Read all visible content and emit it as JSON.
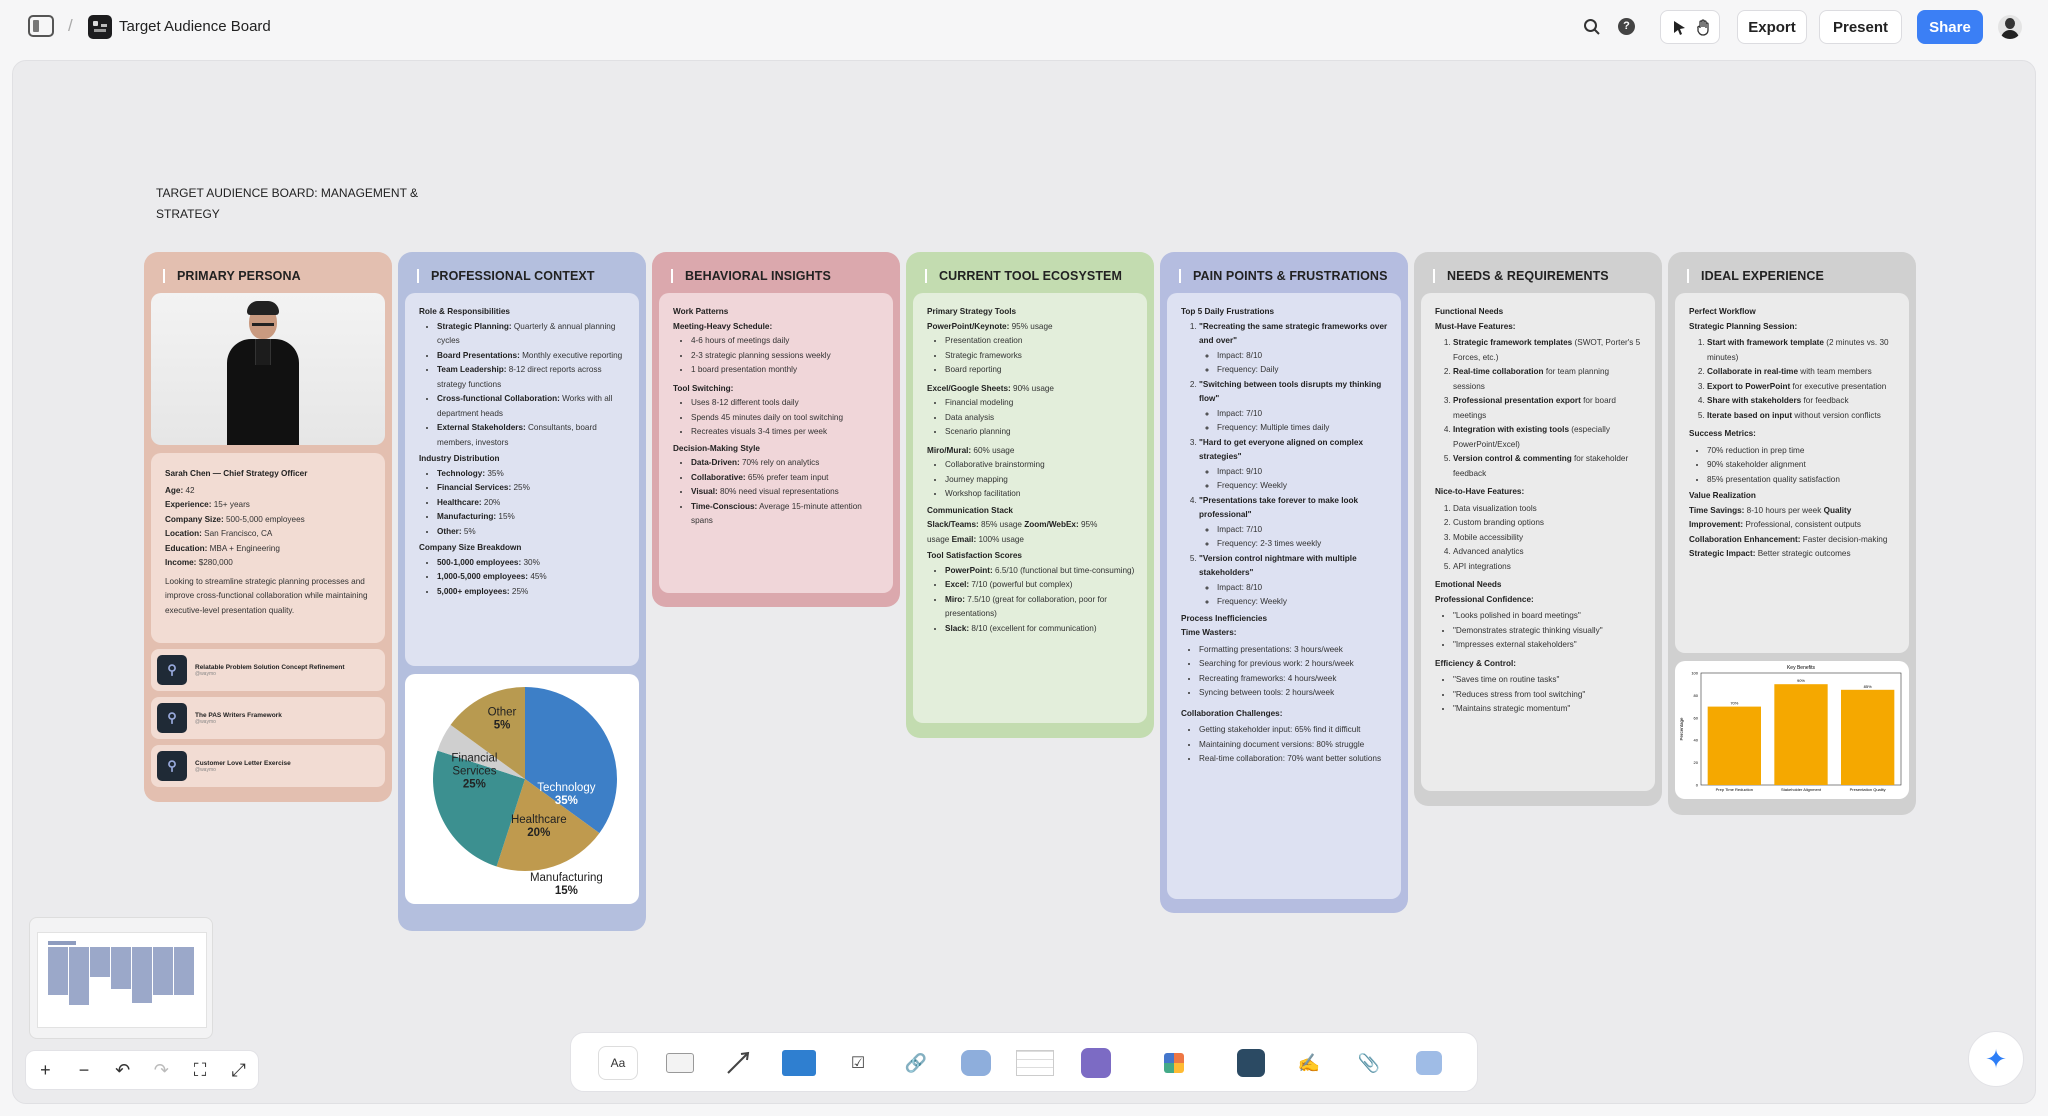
{
  "app": {
    "board_title": "Target Audience Board",
    "export_label": "Export",
    "present_label": "Present",
    "share_label": "Share",
    "accent": "#3b7ff5"
  },
  "board": {
    "heading_line1": "TARGET AUDIENCE BOARD: MANAGEMENT &",
    "heading_line2": "STRATEGY"
  },
  "persona": {
    "title": "PRIMARY PERSONA",
    "color": "#e3bfb0",
    "name_line": "Sarah Chen — Chief Strategy Officer",
    "fields": [
      {
        "k": "Age:",
        "v": "42"
      },
      {
        "k": "Experience:",
        "v": "15+ years"
      },
      {
        "k": "Company Size:",
        "v": "500-5,000 employees"
      },
      {
        "k": "Location:",
        "v": "San Francisco, CA"
      },
      {
        "k": "Education:",
        "v": "MBA + Engineering"
      },
      {
        "k": "Income:",
        "v": "$280,000"
      }
    ],
    "quote": "Looking to streamline strategic planning processes and improve cross-functional collaboration while maintaining executive-level presentation quality.",
    "links": [
      {
        "title": "Relatable Problem Solution Concept Refinement",
        "sub": "@waymo"
      },
      {
        "title": "The PAS Writers Framework",
        "sub": "@waymo"
      },
      {
        "title": "Customer Love Letter Exercise",
        "sub": "@waymo"
      }
    ]
  },
  "professional": {
    "title": "PROFESSIONAL CONTEXT",
    "color": "#b4bfde",
    "role_heading": "Role & Responsibilities",
    "roles": [
      {
        "k": "Strategic Planning:",
        "v": "Quarterly & annual planning cycles"
      },
      {
        "k": "Board Presentations:",
        "v": "Monthly executive reporting"
      },
      {
        "k": "Team Leadership:",
        "v": "8-12 direct reports across strategy functions"
      },
      {
        "k": "Cross-functional Collaboration:",
        "v": "Works with all department heads"
      },
      {
        "k": "External Stakeholders:",
        "v": "Consultants, board members, investors"
      }
    ],
    "industry_heading": "Industry Distribution",
    "industries": [
      {
        "k": "Technology:",
        "v": "35%"
      },
      {
        "k": "Financial Services:",
        "v": "25%"
      },
      {
        "k": "Healthcare:",
        "v": "20%"
      },
      {
        "k": "Manufacturing:",
        "v": "15%"
      },
      {
        "k": "Other:",
        "v": "5%"
      }
    ],
    "size_heading": "Company Size Breakdown",
    "sizes": [
      {
        "k": "500-1,000 employees:",
        "v": "30%"
      },
      {
        "k": "1,000-5,000 employees:",
        "v": "45%"
      },
      {
        "k": "5,000+ employees:",
        "v": "25%"
      }
    ]
  },
  "chart_data": [
    {
      "type": "pie",
      "categories": [
        "Technology",
        "Healthcare",
        "Financial Services",
        "Other",
        "Manufacturing"
      ],
      "values": [
        35,
        20,
        25,
        5,
        15
      ],
      "labels": [
        "Technology\n35%",
        "Healthcare\n20%",
        "Financial\nServices\n25%",
        "Other\n5%",
        "Manufacturing\n15%"
      ],
      "colors": [
        "#3d7fc7",
        "#bf9a4e",
        "#3c9090",
        "#cfcfcf",
        "#b89a50"
      ]
    },
    {
      "type": "bar",
      "title": "Key Benefits",
      "categories": [
        "Prep Time Reduction",
        "Stakeholder Alignment",
        "Presentation Quality"
      ],
      "values": [
        70,
        90,
        85
      ],
      "data_labels": [
        "70%",
        "90%",
        "85%"
      ],
      "ylabel": "Percentage",
      "ylim": [
        0,
        100
      ],
      "color": "#f5a800"
    }
  ],
  "behavioral": {
    "title": "BEHAVIORAL INSIGHTS",
    "color": "#dba8ad",
    "work_heading": "Work Patterns",
    "meeting_heading": "Meeting-Heavy Schedule:",
    "meeting": [
      "4-6 hours of meetings daily",
      "2-3 strategic planning sessions weekly",
      "1 board presentation monthly"
    ],
    "switch_heading": "Tool Switching:",
    "switching": [
      "Uses 8-12 different tools daily",
      "Spends 45 minutes daily on tool switching",
      "Recreates visuals 3-4 times per week"
    ],
    "decision_heading": "Decision-Making Style",
    "decision": [
      {
        "k": "Data-Driven:",
        "v": "70% rely on analytics"
      },
      {
        "k": "Collaborative:",
        "v": "65% prefer team input"
      },
      {
        "k": "Visual:",
        "v": "80% need visual representations"
      },
      {
        "k": "Time-Conscious:",
        "v": "Average 15-minute attention spans"
      }
    ]
  },
  "tools": {
    "title": "CURRENT TOOL ECOSYSTEM",
    "color": "#c3dcb0",
    "primary_heading": "Primary Strategy Tools",
    "ppt_heading": "PowerPoint/Keynote:",
    "ppt_usage": "95% usage",
    "ppt": [
      "Presentation creation",
      "Strategic frameworks",
      "Board reporting"
    ],
    "excel_heading": "Excel/Google Sheets:",
    "excel_usage": "90% usage",
    "excel": [
      "Financial modeling",
      "Data analysis",
      "Scenario planning"
    ],
    "miro_heading": "Miro/Mural:",
    "miro_usage": "60% usage",
    "miro": [
      "Collaborative brainstorming",
      "Journey mapping",
      "Workshop facilitation"
    ],
    "comm_heading": "Communication Stack",
    "comm_line1_a": "Slack/Teams:",
    "comm_line1_b": "85% usage",
    "comm_line1_c": "Zoom/WebEx:",
    "comm_line1_d": "95%",
    "comm_line2_a": "usage",
    "comm_line2_b": "Email:",
    "comm_line2_c": "100% usage",
    "sat_heading": "Tool Satisfaction Scores",
    "satisfaction": [
      {
        "k": "PowerPoint:",
        "v": "6.5/10 (functional but time-consuming)"
      },
      {
        "k": "Excel:",
        "v": "7/10 (powerful but complex)"
      },
      {
        "k": "Miro:",
        "v": "7.5/10 (great for collaboration, poor for presentations)"
      },
      {
        "k": "Slack:",
        "v": "8/10 (excellent for communication)"
      }
    ]
  },
  "pain": {
    "title": "PAIN POINTS & FRUSTRATIONS",
    "color": "#b5bde0",
    "top_heading": "Top 5 Daily Frustrations",
    "frustrations": [
      {
        "title": "\"Recreating the same strategic frameworks over and over\"",
        "impact": "Impact: 8/10",
        "freq": "Frequency: Daily"
      },
      {
        "title": "\"Switching between tools disrupts my thinking flow\"",
        "impact": "Impact: 7/10",
        "freq": "Frequency: Multiple times daily"
      },
      {
        "title": "\"Hard to get everyone aligned on complex strategies\"",
        "impact": "Impact: 9/10",
        "freq": "Frequency: Weekly"
      },
      {
        "title": "\"Presentations take forever to make look professional\"",
        "impact": "Impact: 7/10",
        "freq": "Frequency: 2-3 times weekly"
      },
      {
        "title": "\"Version control nightmare with multiple stakeholders\"",
        "impact": "Impact: 8/10",
        "freq": "Frequency: Weekly"
      }
    ],
    "process_heading": "Process Inefficiencies",
    "waste_heading": "Time Wasters:",
    "wasters": [
      "Formatting presentations: 3 hours/week",
      "Searching for previous work: 2 hours/week",
      "Recreating frameworks: 4 hours/week",
      "Syncing between tools: 2 hours/week"
    ],
    "collab_heading": "Collaboration Challenges:",
    "collab": [
      "Getting stakeholder input: 65% find it difficult",
      "Maintaining document versions: 80% struggle",
      "Real-time collaboration: 70% want better solutions"
    ]
  },
  "needs": {
    "title": "NEEDS & REQUIREMENTS",
    "color": "#d0d0d0",
    "functional_heading": "Functional Needs",
    "must_heading": "Must-Have Features:",
    "must": [
      {
        "k": "Strategic framework templates",
        "v": "(SWOT, Porter's 5 Forces, etc.)"
      },
      {
        "k": "Real-time collaboration",
        "v": "for team planning sessions"
      },
      {
        "k": "Professional presentation export",
        "v": "for board meetings"
      },
      {
        "k": "Integration with existing tools",
        "v": "(especially PowerPoint/Excel)"
      },
      {
        "k": "Version control & commenting",
        "v": "for stakeholder feedback"
      }
    ],
    "nice_heading": "Nice-to-Have Features:",
    "nice": [
      "Data visualization tools",
      "Custom branding options",
      "Mobile accessibility",
      "Advanced analytics",
      "API integrations"
    ],
    "emotional_heading": "Emotional Needs",
    "confidence_heading": "Professional Confidence:",
    "confidence": [
      "\"Looks polished in board meetings\"",
      "\"Demonstrates strategic thinking visually\"",
      "\"Impresses external stakeholders\""
    ],
    "efficiency_heading": "Efficiency & Control:",
    "efficiency": [
      "\"Saves time on routine tasks\"",
      "\"Reduces stress from tool switching\"",
      "\"Maintains strategic momentum\""
    ]
  },
  "ideal": {
    "title": "IDEAL EXPERIENCE",
    "color": "#d0d0d0",
    "workflow_heading": "Perfect Workflow",
    "session_heading": "Strategic Planning Session:",
    "steps": [
      {
        "k": "Start with framework template",
        "v": "(2 minutes vs. 30 minutes)"
      },
      {
        "k": "Collaborate in real-time",
        "v": "with team members"
      },
      {
        "k": "Export to PowerPoint",
        "v": "for executive presentation"
      },
      {
        "k": "Share with stakeholders",
        "v": "for feedback"
      },
      {
        "k": "Iterate based on input",
        "v": "without version conflicts"
      }
    ],
    "metrics_heading": "Success Metrics:",
    "metrics": [
      "70% reduction in prep time",
      "90% stakeholder alignment",
      "85% presentation quality satisfaction"
    ],
    "value_heading": "Value Realization",
    "value_lines": [
      {
        "k": "Time Savings:",
        "v": "8-10 hours per week"
      },
      {
        "k": "Quality Improvement:",
        "v": "Professional, consistent outputs"
      },
      {
        "k": "Collaboration Enhancement:",
        "v": "Faster decision-making"
      },
      {
        "k": "Strategic Impact:",
        "v": "Better strategic outcomes"
      }
    ]
  },
  "icons": {
    "sidebar": "sidebar-toggle-icon",
    "logo": "board-logo-icon",
    "search": "search-icon",
    "help": "help-icon",
    "pointer": "pointer-icon",
    "hand": "hand-icon",
    "avatar": "user-avatar",
    "ai": "sparkle-icon"
  }
}
